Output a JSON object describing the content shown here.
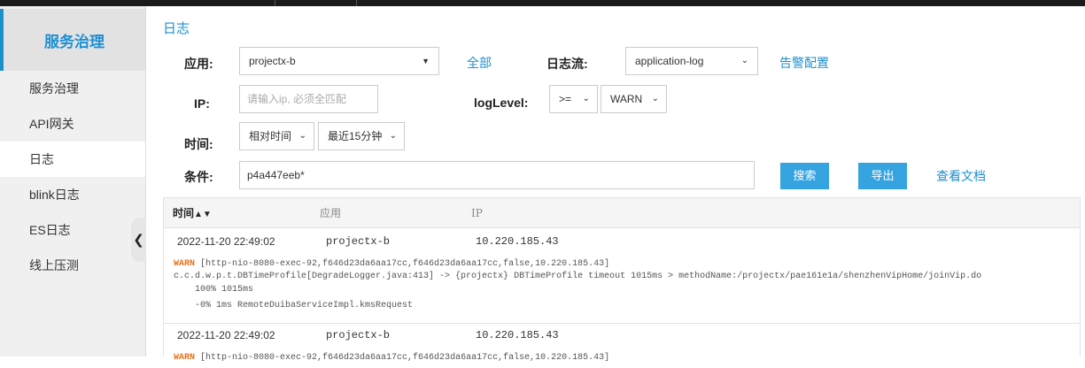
{
  "sidebar": {
    "brand": "服务治理",
    "items": [
      {
        "label": "服务治理"
      },
      {
        "label": "API网关"
      },
      {
        "label": "日志"
      },
      {
        "label": "blink日志"
      },
      {
        "label": "ES日志"
      },
      {
        "label": "线上压测"
      }
    ],
    "active_index": 2
  },
  "page": {
    "title": "日志"
  },
  "filters": {
    "app_label": "应用:",
    "app_value": "projectx-b",
    "all_link": "全部",
    "stream_label": "日志流:",
    "stream_value": "application-log",
    "alert_link": "告警配置",
    "ip_label": "IP:",
    "ip_placeholder": "请输入ip, 必须全匹配",
    "loglevel_label": "logLevel:",
    "op_value": ">=",
    "level_value": "WARN",
    "time_label": "时间:",
    "time_mode": "相对时间",
    "time_range": "最近15分钟",
    "cond_label": "条件:",
    "cond_value": "p4a447eeb*",
    "search_button": "搜索",
    "export_button": "导出",
    "docs_link": "查看文档"
  },
  "table": {
    "headers": {
      "time": "时间",
      "sort_arrows": "▲▼",
      "app": "应用",
      "ip": "IP"
    },
    "rows": [
      {
        "time": "2022-11-20 22:49:02",
        "app": "projectx-b",
        "ip": "10.220.185.43",
        "level": "WARN",
        "line1": " [http-nio-8080-exec-92,f646d23da6aa17cc,f646d23da6aa17cc,false,10.220.185.43]",
        "line2": "c.c.d.w.p.t.DBTimeProfile[DegradeLogger.java:413] -> {projectx} DBTimeProfile timeout 1015ms > methodName:/projectx/pae161e1a/shenzhenVipHome/joinVip.do",
        "line3": "    100% 1015ms",
        "line4": "    -0% 1ms RemoteDuibaServiceImpl.kmsRequest"
      },
      {
        "time": "2022-11-20 22:49:02",
        "app": "projectx-b",
        "ip": "10.220.185.43",
        "level": "WARN",
        "line1": " [http-nio-8080-exec-92,f646d23da6aa17cc,f646d23da6aa17cc,false,10.220.185.43]"
      }
    ]
  }
}
